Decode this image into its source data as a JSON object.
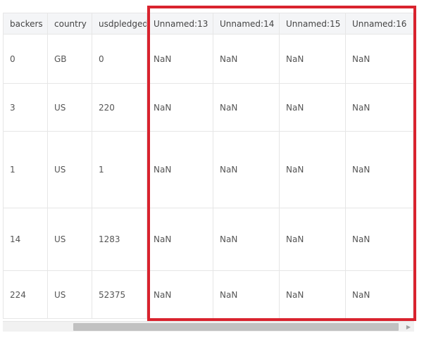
{
  "table": {
    "columns": [
      "backers",
      "country",
      "usdpledged",
      "Unnamed:13",
      "Unnamed:14",
      "Unnamed:15",
      "Unnamed:16"
    ],
    "rows": [
      [
        "0",
        "GB",
        "0",
        "NaN",
        "NaN",
        "NaN",
        "NaN"
      ],
      [
        "3",
        "US",
        "220",
        "NaN",
        "NaN",
        "NaN",
        "NaN"
      ],
      [
        "1",
        "US",
        "1",
        "NaN",
        "NaN",
        "NaN",
        "NaN"
      ],
      [
        "14",
        "US",
        "1283",
        "NaN",
        "NaN",
        "NaN",
        "NaN"
      ],
      [
        "224",
        "US",
        "52375",
        "NaN",
        "NaN",
        "NaN",
        "NaN"
      ]
    ]
  },
  "scrollbar": {
    "right_arrow_icon": "chevron-right-icon"
  },
  "highlight": {
    "color": "#d9232e"
  }
}
